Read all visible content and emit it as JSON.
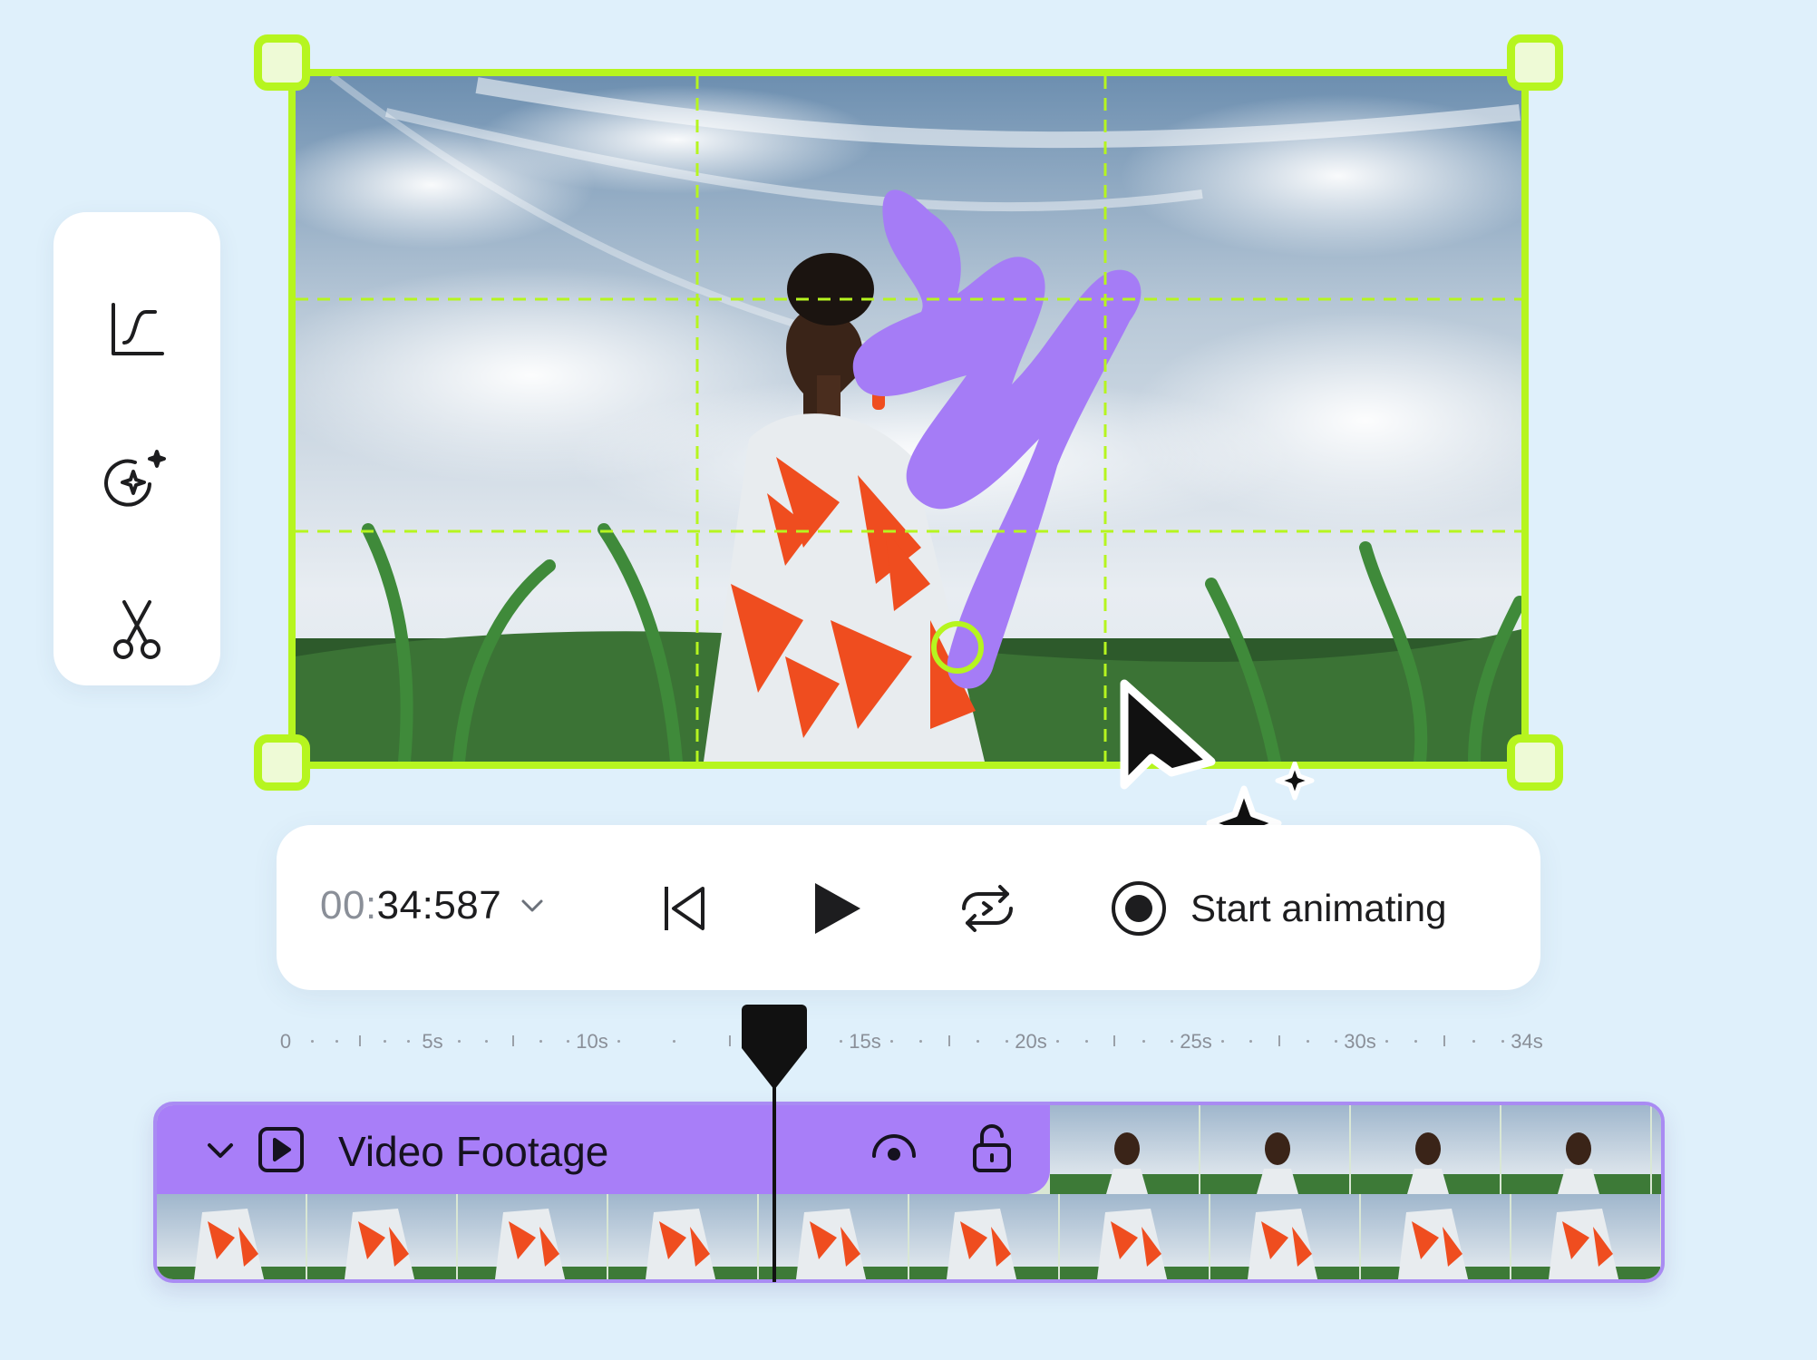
{
  "tools": [
    {
      "name": "curve-tool",
      "icon": "curve-icon"
    },
    {
      "name": "ai-effects-tool",
      "icon": "sparkle-refresh-icon"
    },
    {
      "name": "cut-tool",
      "icon": "scissors-icon"
    }
  ],
  "playback": {
    "timecode_prefix": "00:",
    "timecode_main": "34:587",
    "start_animating_label": "Start animating"
  },
  "ruler": {
    "labels": [
      "0",
      "5s",
      "10s",
      "15s",
      "20s",
      "25s",
      "30s",
      "34s"
    ]
  },
  "track": {
    "title": "Video Footage"
  },
  "colors": {
    "selection": "#b6f51f",
    "track": "#a87ef8",
    "background": "#dff0fb"
  }
}
